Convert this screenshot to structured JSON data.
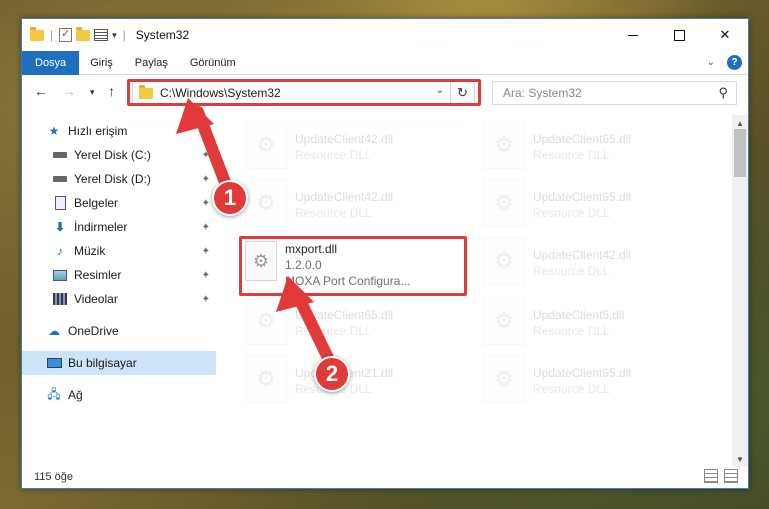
{
  "window": {
    "title": "System32"
  },
  "ribbon": {
    "tabs": [
      "Dosya",
      "Giriş",
      "Paylaş",
      "Görünüm"
    ]
  },
  "nav": {
    "address": "C:\\Windows\\System32",
    "search_placeholder": "Ara: System32"
  },
  "sidebar": {
    "quick_access_label": "Hızlı erişim",
    "items": [
      {
        "label": "Yerel Disk (C:)",
        "icon": "drive-icon",
        "pinned": true
      },
      {
        "label": "Yerel Disk (D:)",
        "icon": "drive-icon",
        "pinned": true
      },
      {
        "label": "Belgeler",
        "icon": "documents-icon",
        "pinned": true
      },
      {
        "label": "İndirmeler",
        "icon": "download-icon",
        "pinned": true
      },
      {
        "label": "Müzik",
        "icon": "music-icon",
        "pinned": true
      },
      {
        "label": "Resimler",
        "icon": "pictures-icon",
        "pinned": true
      },
      {
        "label": "Videolar",
        "icon": "video-icon",
        "pinned": true
      }
    ],
    "onedrive_label": "OneDrive",
    "this_pc_label": "Bu bilgisayar",
    "network_label": "Ağ"
  },
  "files": {
    "highlighted": {
      "name": "mxport.dll",
      "version": "1.2.0.0",
      "description": "MOXA Port Configura..."
    },
    "faded": [
      {
        "name": "UpdateClient42.dll",
        "type": "Resource DLL"
      },
      {
        "name": "UpdateClient65.dll",
        "type": "Resource DLL"
      },
      {
        "name": "UpdateClient42.dll",
        "type": "Resource DLL"
      },
      {
        "name": "UpdateClient65.dll",
        "type": "Resource DLL"
      },
      {
        "name": "UpdateClient42.dll",
        "type": "Resource DLL"
      },
      {
        "name": "UpdateClient65.dll",
        "type": "Resource DLL"
      },
      {
        "name": "UpdateClient5.dll",
        "type": "Resource DLL"
      },
      {
        "name": "UpdateClient21.dll",
        "type": "Resource DLL"
      },
      {
        "name": "UpdateClient65.dll",
        "type": "Resource DLL"
      }
    ]
  },
  "status": {
    "item_count": "115 öğe"
  },
  "annotations": {
    "step1": "1",
    "step2": "2",
    "color": "#e03a3a"
  }
}
